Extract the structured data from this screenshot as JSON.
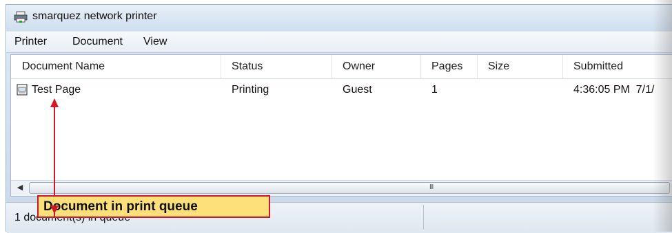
{
  "window": {
    "title": "smarquez network printer",
    "icon": "printer-icon"
  },
  "menu": [
    "Printer",
    "Document",
    "View"
  ],
  "columns": [
    "Document Name",
    "Status",
    "Owner",
    "Pages",
    "Size",
    "Submitted"
  ],
  "rows": [
    {
      "document_name": "Test Page",
      "status": "Printing",
      "owner": "Guest",
      "pages": "1",
      "size": "",
      "submitted": "4:36:05 PM  7/1/"
    }
  ],
  "statusbar": {
    "text": "1 document(s) in queue"
  },
  "callout": {
    "text": "Document in print queue"
  },
  "scrollbar": {
    "left_arrow": "◀",
    "grip": "III"
  },
  "colors": {
    "callout_fill": "#fde07a",
    "callout_border": "#d1162a",
    "arrow": "#d1162a"
  }
}
